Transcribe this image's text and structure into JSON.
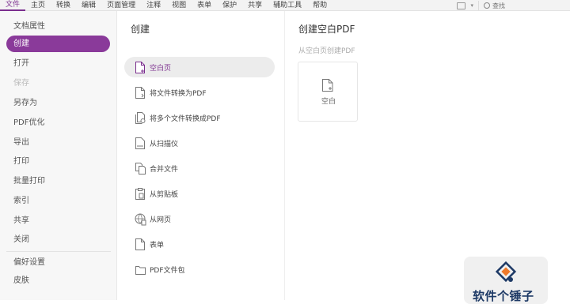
{
  "menubar": {
    "items": [
      {
        "label": "文件",
        "active": true
      },
      {
        "label": "主页"
      },
      {
        "label": "转换"
      },
      {
        "label": "编辑"
      },
      {
        "label": "页面管理"
      },
      {
        "label": "注释"
      },
      {
        "label": "视图"
      },
      {
        "label": "表单"
      },
      {
        "label": "保护"
      },
      {
        "label": "共享"
      },
      {
        "label": "辅助工具"
      },
      {
        "label": "帮助"
      }
    ],
    "search_placeholder": "查找"
  },
  "sidebar": {
    "items": [
      {
        "label": "文档属性"
      },
      {
        "label": "创建",
        "selected": true
      },
      {
        "label": "打开"
      },
      {
        "label": "保存",
        "disabled": true
      },
      {
        "label": "另存为"
      },
      {
        "label": "PDF优化"
      },
      {
        "label": "导出"
      },
      {
        "label": "打印"
      },
      {
        "label": "批量打印"
      },
      {
        "label": "索引"
      },
      {
        "label": "共享"
      },
      {
        "label": "关闭"
      },
      {
        "label": "偏好设置"
      },
      {
        "label": "皮肤"
      }
    ]
  },
  "create_panel": {
    "title": "创建",
    "options": [
      {
        "label": "空白页",
        "icon": "blank-page-icon",
        "selected": true
      },
      {
        "label": "将文件转换为PDF",
        "icon": "file-convert-icon"
      },
      {
        "label": "将多个文件转换成PDF",
        "icon": "multi-file-convert-icon"
      },
      {
        "label": "从扫描仪",
        "icon": "scanner-icon"
      },
      {
        "label": "合并文件",
        "icon": "merge-files-icon"
      },
      {
        "label": "从剪贴板",
        "icon": "clipboard-icon"
      },
      {
        "label": "从网页",
        "icon": "web-page-icon"
      },
      {
        "label": "表单",
        "icon": "form-icon"
      },
      {
        "label": "PDF文件包",
        "icon": "pdf-package-icon"
      }
    ]
  },
  "detail_pane": {
    "title": "创建空白PDF",
    "subtitle": "从空白页创建PDF",
    "tile_label": "空白"
  },
  "watermark": {
    "text": "软件个锤子"
  },
  "colors": {
    "accent": "#8a3a9a",
    "accent_text": "#7b2e8e",
    "sidebar_bg": "#f7f7f7",
    "selected_option_bg": "#ececec"
  }
}
